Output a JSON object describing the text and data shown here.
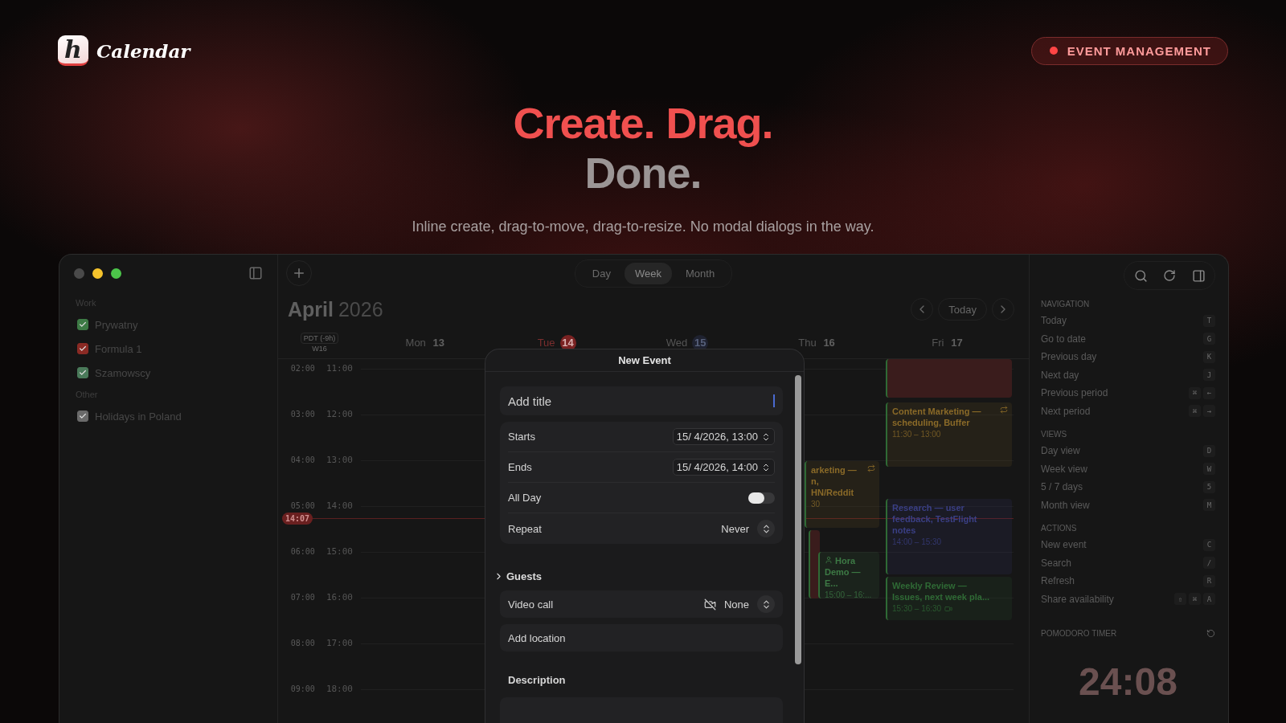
{
  "brand": {
    "mark": "h",
    "name": "Calendar"
  },
  "badge": {
    "label": "EVENT MANAGEMENT"
  },
  "hero": {
    "line1": "Create. Drag.",
    "line2": "Done.",
    "subtitle": "Inline create, drag-to-move, drag-to-resize. No modal dialogs in the way."
  },
  "sidebar": {
    "groups": [
      {
        "title": "Work",
        "calendars": [
          {
            "name": "Prywatny",
            "checked": true,
            "color": "#3d7a45"
          },
          {
            "name": "Formula 1",
            "checked": true,
            "color": "#8a2a24"
          },
          {
            "name": "Szamowscy",
            "checked": true,
            "color": "#4a7a5a"
          }
        ]
      },
      {
        "title": "Other",
        "calendars": [
          {
            "name": "Holidays in Poland",
            "checked": true,
            "color": "#6a6a6a"
          }
        ]
      }
    ]
  },
  "view_tabs": [
    {
      "label": "Day",
      "selected": false
    },
    {
      "label": "Week",
      "selected": true
    },
    {
      "label": "Month",
      "selected": false
    }
  ],
  "header": {
    "month": "April",
    "year": "2026",
    "today": "Today"
  },
  "week": {
    "timezone": "PDT (-9h)",
    "week_label": "W16",
    "days": [
      {
        "name": "Mon",
        "number": "13",
        "kind": "plain"
      },
      {
        "name": "Tue",
        "number": "14",
        "kind": "today"
      },
      {
        "name": "Wed",
        "number": "15",
        "kind": "selected"
      },
      {
        "name": "Thu",
        "number": "16",
        "kind": "plain"
      },
      {
        "name": "Fri",
        "number": "17",
        "kind": "plain"
      }
    ]
  },
  "hours": [
    {
      "secondary": "02:00",
      "local": "11:00"
    },
    {
      "secondary": "03:00",
      "local": "12:00"
    },
    {
      "secondary": "04:00",
      "local": "13:00"
    },
    {
      "secondary": "05:00",
      "local": "14:00"
    },
    {
      "secondary": "06:00",
      "local": "15:00"
    },
    {
      "secondary": "07:00",
      "local": "16:00"
    },
    {
      "secondary": "08:00",
      "local": "17:00"
    },
    {
      "secondary": "09:00",
      "local": "18:00"
    }
  ],
  "now": {
    "label": "14:07"
  },
  "events": [
    {
      "color": "#3a1c1c"
    },
    {
      "title": "Content Marketing — scheduling, Buffer",
      "time": "11:30 – 13:00",
      "color": "#8a6a28",
      "repeat": true
    },
    {
      "title": "arketing — n, HN/Reddit",
      "time": "30",
      "color": "#8a6a28",
      "repeat": true
    },
    {
      "color": "#3a1c1c"
    },
    {
      "title": "Hora Demo — E...",
      "time": "15:00 – 16:...",
      "color": "#3d7a45",
      "person": true
    },
    {
      "title": "Research — user feedback, TestFlight notes",
      "time": "14:00 – 15:30",
      "color": "#3a3f85"
    },
    {
      "title": "Weekly Review — Issues, next week pla...",
      "time": "15:30 – 16:30",
      "color": "#2f6a35",
      "video": true
    }
  ],
  "dialog": {
    "title": "New Event",
    "title_placeholder": "Add title",
    "rows": [
      {
        "kind": "datetime",
        "label": "Starts",
        "value": "15/ 4/2026, 13:00"
      },
      {
        "kind": "datetime",
        "label": "Ends",
        "value": "15/ 4/2026, 14:00"
      },
      {
        "kind": "toggle",
        "label": "All Day",
        "on": false
      },
      {
        "kind": "select",
        "label": "Repeat",
        "value": "Never"
      }
    ],
    "guests": {
      "label": "Guests",
      "expanded": false
    },
    "video": {
      "label": "Video call",
      "value": "None"
    },
    "location_placeholder": "Add location",
    "description_label": "Description"
  },
  "shortcuts": [
    {
      "title": "NAVIGATION",
      "items": [
        {
          "label": "Today",
          "keys": [
            "T"
          ]
        },
        {
          "label": "Go to date",
          "keys": [
            "G"
          ]
        },
        {
          "label": "Previous day",
          "keys": [
            "K"
          ]
        },
        {
          "label": "Next day",
          "keys": [
            "J"
          ]
        },
        {
          "label": "Previous period",
          "keys": [
            "⌘",
            "←"
          ]
        },
        {
          "label": "Next period",
          "keys": [
            "⌘",
            "→"
          ]
        }
      ]
    },
    {
      "title": "VIEWS",
      "items": [
        {
          "label": "Day view",
          "keys": [
            "D"
          ]
        },
        {
          "label": "Week view",
          "keys": [
            "W"
          ]
        },
        {
          "label": "5 / 7 days",
          "keys": [
            "5"
          ]
        },
        {
          "label": "Month view",
          "keys": [
            "M"
          ]
        }
      ]
    },
    {
      "title": "ACTIONS",
      "items": [
        {
          "label": "New event",
          "keys": [
            "C"
          ]
        },
        {
          "label": "Search",
          "keys": [
            "/"
          ]
        },
        {
          "label": "Refresh",
          "keys": [
            "R"
          ]
        },
        {
          "label": "Share availability",
          "keys": [
            "⇧",
            "⌘",
            "A"
          ]
        }
      ]
    }
  ],
  "pomodoro": {
    "title": "POMODORO TIMER",
    "time": "24:08"
  }
}
